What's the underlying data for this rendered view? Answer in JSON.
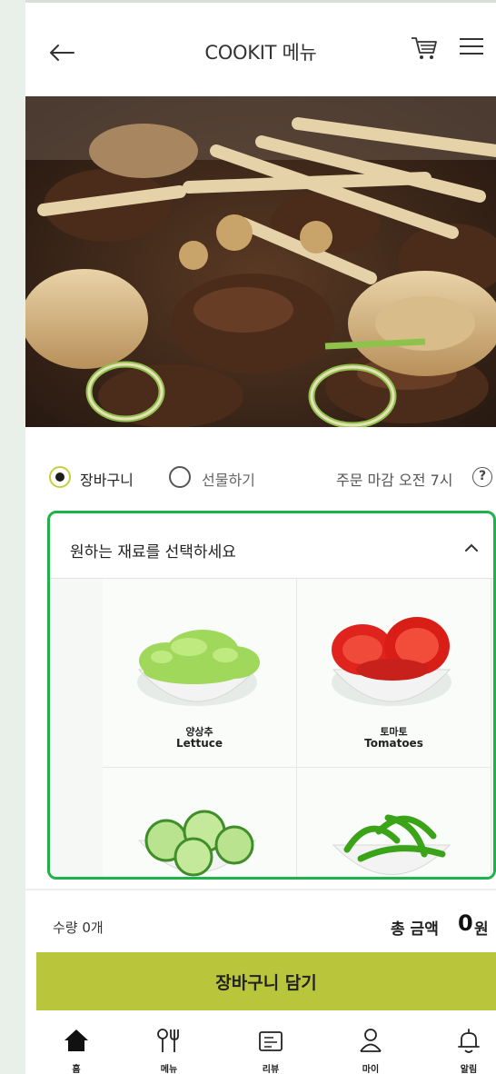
{
  "header": {
    "title": "COOKIT 메뉴"
  },
  "options": {
    "cart_option": "장바구니",
    "gift_option": "선물하기",
    "deadline": "주문 마감 오전 7시"
  },
  "ingredients": {
    "title": "원하는 재료를 선택하세요",
    "items": [
      {
        "name_ko": "양상추",
        "name_en": "Lettuce"
      },
      {
        "name_ko": "토마토",
        "name_en": "Tomatoes"
      }
    ]
  },
  "summary": {
    "quantity": "수량 0개",
    "total_label": "총 금액",
    "total_value": "0",
    "total_unit": "원"
  },
  "cta": {
    "label": "장바구니 담기"
  },
  "nav": {
    "items": [
      {
        "label": "홈",
        "icon": "home-icon"
      },
      {
        "label": "메뉴",
        "icon": "utensils-icon"
      },
      {
        "label": "리뷰",
        "icon": "review-icon"
      },
      {
        "label": "마이",
        "icon": "user-icon"
      },
      {
        "label": "알림",
        "icon": "bell-icon"
      }
    ]
  },
  "colors": {
    "accent": "#b9c63c",
    "highlight_border": "#1fb24a"
  }
}
